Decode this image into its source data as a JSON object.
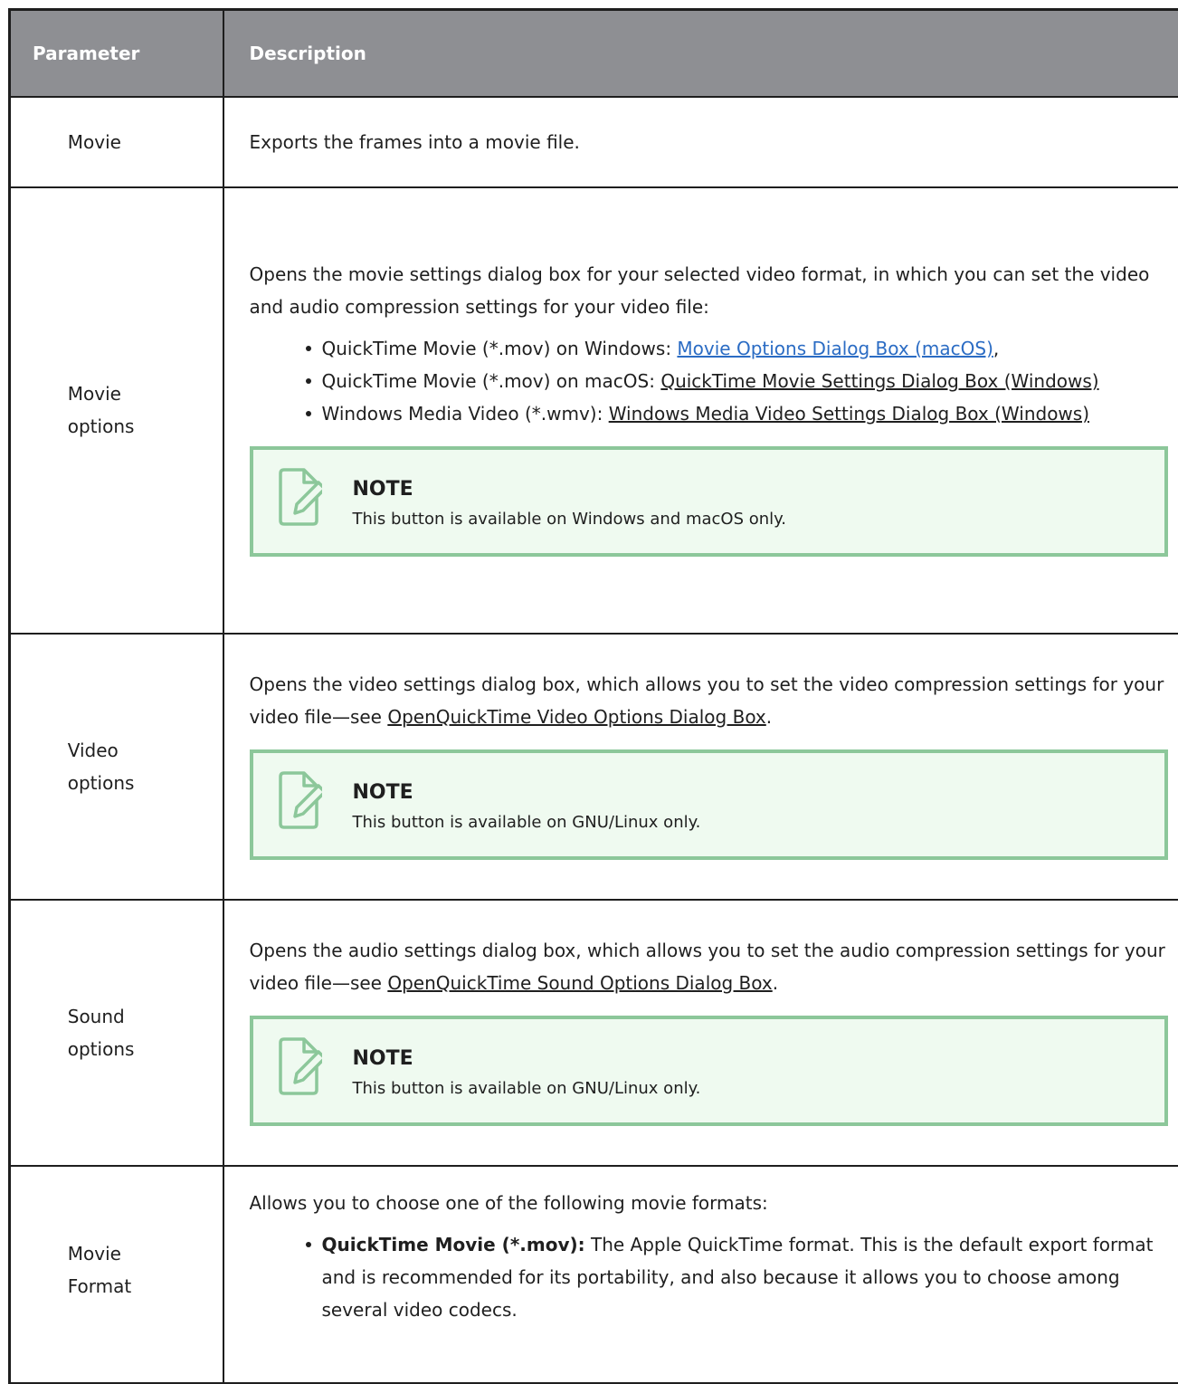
{
  "header": {
    "col1": "Parameter",
    "col2": "Description"
  },
  "rows": [
    {
      "param": "Movie",
      "desc": "Exports the frames into a movie file."
    },
    {
      "param": "Movie options",
      "desc": "Opens the movie settings dialog box for your selected video format, in which you can set the video and audio compression settings for your video file:",
      "bullets": [
        {
          "prefix": "QuickTime Movie (*.mov) on Windows: ",
          "link": "Movie Options Dialog Box (macOS)",
          "suffix": ","
        },
        {
          "prefix": "QuickTime Movie (*.mov) on macOS: ",
          "link": "QuickTime Movie Settings Dialog Box (Windows)",
          "suffix": ""
        },
        {
          "prefix": "Windows Media Video (*.wmv): ",
          "link": "Windows Media Video Settings Dialog Box (Windows)",
          "suffix": ""
        }
      ],
      "note": {
        "title": "NOTE",
        "text": "This button is available on Windows and macOS only."
      }
    },
    {
      "param": "Video options",
      "desc_prefix": "Opens the video settings dialog box, which allows you to set the video compression settings for your video file—see ",
      "desc_link": "OpenQuickTime Video Options Dialog Box",
      "desc_suffix": ".",
      "note": {
        "title": "NOTE",
        "text": "This button is available on GNU/Linux only."
      }
    },
    {
      "param": "Sound options",
      "desc_prefix": "Opens the audio settings dialog box, which allows you to set the audio compression settings for your video file—see ",
      "desc_link": "OpenQuickTime Sound Options Dialog Box",
      "desc_suffix": ".",
      "note": {
        "title": "NOTE",
        "text": "This button is available on GNU/Linux only."
      }
    },
    {
      "param": "Movie Format",
      "desc": "Allows you to choose one of the following movie formats:",
      "bullets": [
        {
          "bold": "QuickTime Movie (*.mov):",
          "text": " The Apple QuickTime format. This is the default export format and is recommended for its portability, and also because it allows you to choose among several video codecs."
        }
      ]
    }
  ],
  "colors": {
    "header_bg": "#8e8f93",
    "note_border": "#8cc79a",
    "note_bg": "#effaf0",
    "link_blue": "#2b6cc4"
  }
}
